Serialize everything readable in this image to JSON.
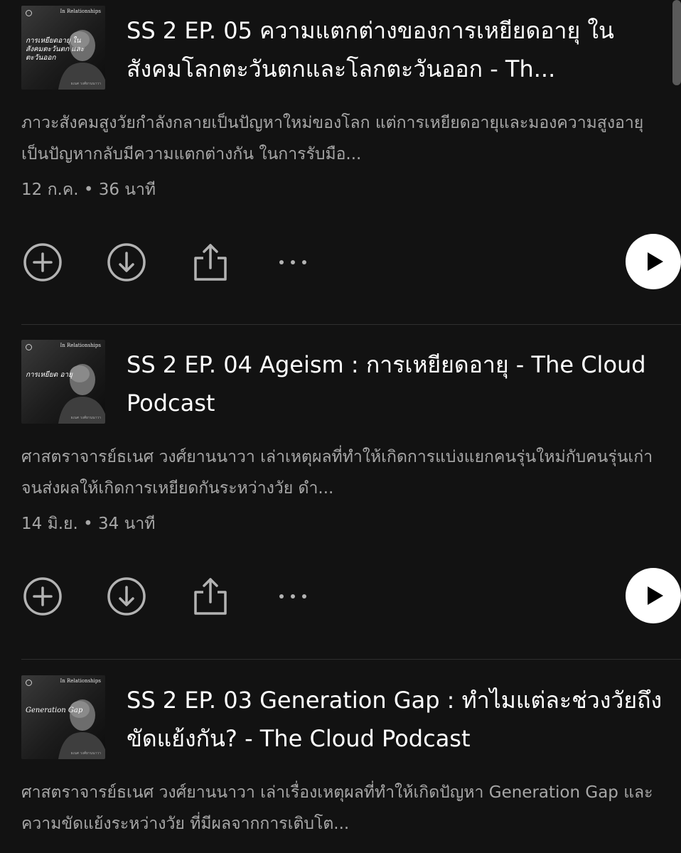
{
  "episodes": [
    {
      "cover": {
        "series": "In Relationships",
        "title": "การเหยียดอายุ ในสังคมตะวันตก และตะวันออก",
        "credit": "ธเนศ วงศ์ยานนาวา"
      },
      "title": "SS 2 EP. 05 ความแตกต่างของการเหยียดอายุ ในสังคมโลกตะวันตกและโลกตะวันออก - Th...",
      "description": "ภาวะสังคมสูงวัยกำลังกลายเป็นปัญหาใหม่ของโลก แต่การเหยียดอายุและมองความสูงอายุเป็นปัญหากลับมีความแตกต่างกัน ในการรับมือ...",
      "meta": "12 ก.ค. • 36 นาที"
    },
    {
      "cover": {
        "series": "In Relationships",
        "title": "การเหยียด อายุ",
        "credit": "ธเนศ วงศ์ยานนาวา"
      },
      "title": "SS 2 EP. 04 Ageism : การเหยียดอายุ - The Cloud Podcast",
      "description": "ศาสตราจารย์ธเนศ วงศ์ยานนาวา เล่าเหตุผลที่ทำให้เกิดการแบ่งแยกคนรุ่นใหม่กับคนรุ่นเก่า จนส่งผลให้เกิดการเหยียดกันระหว่างวัย  ดำ...",
      "meta": "14 มิ.ย. • 34 นาที"
    },
    {
      "cover": {
        "series": "In Relationships",
        "title": "Generation Gap",
        "credit": "ธเนศ วงศ์ยานนาวา"
      },
      "title": "SS 2 EP. 03 Generation Gap : ทำไมแต่ละช่วงวัยถึงขัดแย้งกัน? - The Cloud Podcast",
      "description": "ศาสตราจารย์ธเนศ วงศ์ยานนาวา เล่าเรื่องเหตุผลที่ทำให้เกิดปัญหา Generation Gap และความขัดแย้งระหว่างวัย ที่มีผลจากการเติบโต...",
      "meta": ""
    }
  ],
  "icons": {
    "add": "plus-circle-icon",
    "download": "download-circle-icon",
    "share": "share-icon",
    "more": "more-dots-icon",
    "play": "play-icon"
  },
  "colors": {
    "background": "#121212",
    "text_primary": "#ffffff",
    "text_secondary": "#a7a7a7",
    "icon": "#b3b3b3",
    "play_button": "#ffffff"
  }
}
